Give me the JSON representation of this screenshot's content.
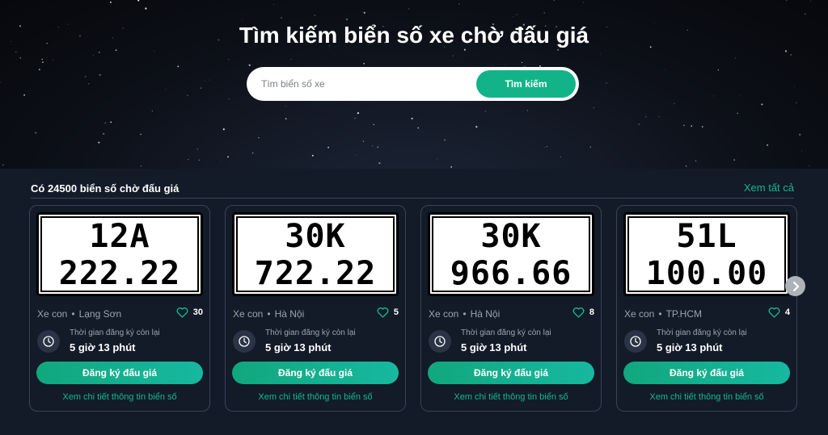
{
  "hero": {
    "title": "Tìm kiếm biển số xe chờ đấu giá",
    "search_placeholder": "Tìm biển số xe",
    "search_button": "Tìm kiếm"
  },
  "section": {
    "title": "Có 24500 biển số chờ đấu giá",
    "view_all": "Xem tất cả"
  },
  "cards": [
    {
      "plate_top": "12A",
      "plate_bottom": "222.22",
      "type": "Xe con",
      "location": "Lạng Sơn",
      "likes": "30",
      "timer_label": "Thời gian đăng ký còn lại",
      "timer_value": "5 giờ 13 phút",
      "register_button": "Đăng ký đấu giá",
      "detail_link": "Xem chi tiết thông tin biển số"
    },
    {
      "plate_top": "30K",
      "plate_bottom": "722.22",
      "type": "Xe con",
      "location": "Hà Nội",
      "likes": "5",
      "timer_label": "Thời gian đăng ký còn lại",
      "timer_value": "5 giờ 13 phút",
      "register_button": "Đăng ký đấu giá",
      "detail_link": "Xem chi tiết thông tin biển số"
    },
    {
      "plate_top": "30K",
      "plate_bottom": "966.66",
      "type": "Xe con",
      "location": "Hà Nội",
      "likes": "8",
      "timer_label": "Thời gian đăng ký còn lại",
      "timer_value": "5 giờ 13 phút",
      "register_button": "Đăng ký đấu giá",
      "detail_link": "Xem chi tiết thông tin biển số"
    },
    {
      "plate_top": "51L",
      "plate_bottom": "100.00",
      "type": "Xe con",
      "location": "TP.HCM",
      "likes": "4",
      "timer_label": "Thời gian đăng ký còn lại",
      "timer_value": "5 giờ 13 phút",
      "register_button": "Đăng ký đấu giá",
      "detail_link": "Xem chi tiết thông tin biển số"
    }
  ],
  "icons": {
    "heart": "heart-icon",
    "clock": "clock-icon",
    "next": "chevron-right-icon"
  },
  "colors": {
    "accent": "#13b38a",
    "background": "#131b29"
  }
}
